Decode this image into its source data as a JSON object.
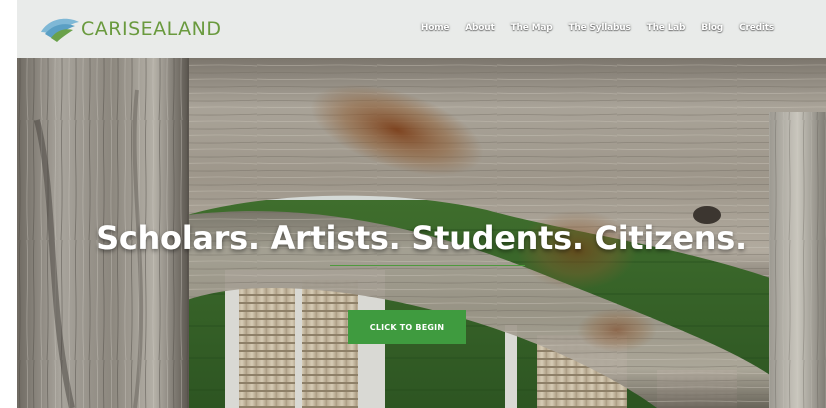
{
  "site": {
    "brand": "CARISEALAND",
    "brand_color": "#6a9a3e",
    "logo_icon": "leaf-wave-logo-icon"
  },
  "nav": {
    "items": [
      {
        "label": "Home"
      },
      {
        "label": "About"
      },
      {
        "label": "The Map"
      },
      {
        "label": "The Syllabus"
      },
      {
        "label": "The Lab"
      },
      {
        "label": "Blog"
      },
      {
        "label": "Credits"
      }
    ]
  },
  "hero": {
    "headline": "Scholars. Artists. Students. Citizens.",
    "cta_label": "CLICK TO BEGIN",
    "cta_color": "#3f9b3f",
    "accent_rule_color": "#4f9a3e"
  }
}
